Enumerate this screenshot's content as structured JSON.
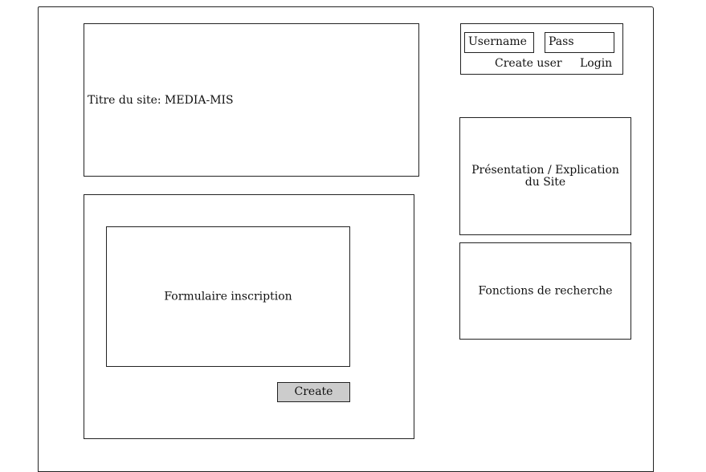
{
  "header": {
    "site_title": "Titre du site: MEDIA-MIS"
  },
  "login": {
    "username_label": "Username",
    "password_label": "Pass",
    "create_user_label": "Create user",
    "login_label": "Login"
  },
  "sidebar": {
    "presentation_text": "Présentation / Explication du Site",
    "search_text": "Fonctions de recherche"
  },
  "signup": {
    "form_text": "Formulaire inscription",
    "create_button_label": "Create"
  },
  "colors": {
    "stroke": "#222222",
    "background": "#ffffff",
    "button_fill": "#cccccc"
  }
}
